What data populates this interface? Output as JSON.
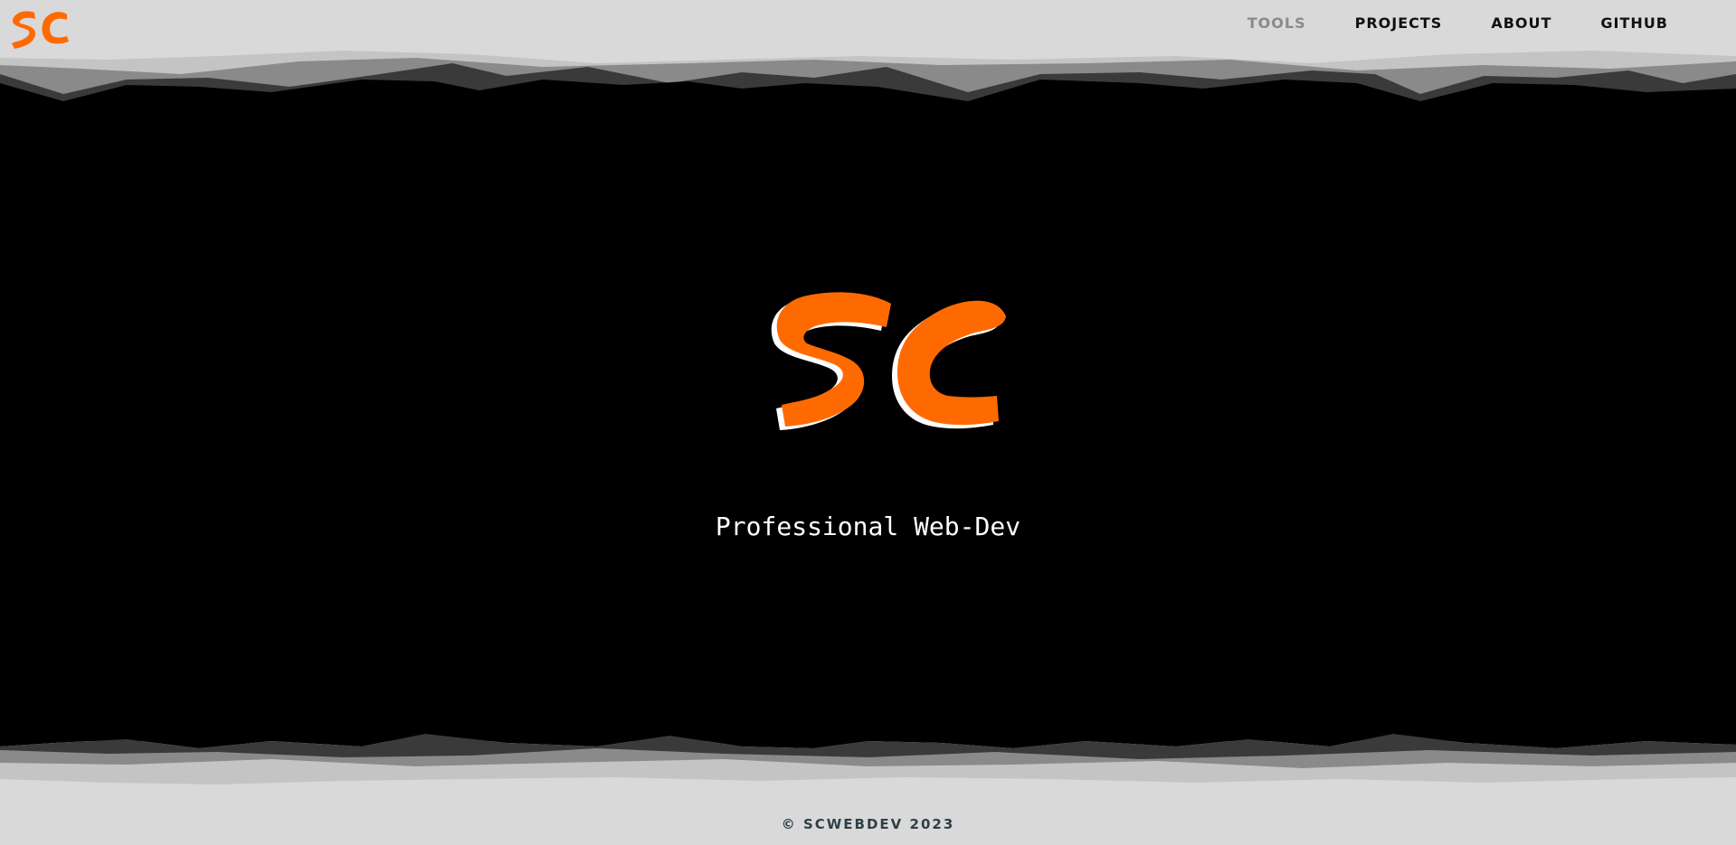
{
  "brand": {
    "logo_text": "SC",
    "accent_color": "#ff6a00"
  },
  "nav": {
    "items": [
      {
        "label": "TOOLS",
        "active": true
      },
      {
        "label": "PROJECTS",
        "active": false
      },
      {
        "label": "ABOUT",
        "active": false
      },
      {
        "label": "GITHUB",
        "active": false
      }
    ]
  },
  "hero": {
    "tagline": "Professional Web-Dev"
  },
  "footer": {
    "copyright": "© SCWEBDEV 2023"
  }
}
